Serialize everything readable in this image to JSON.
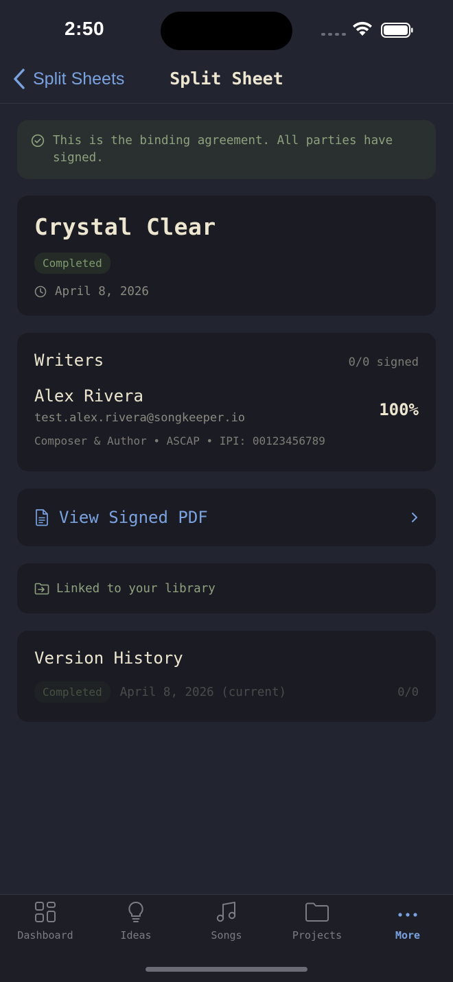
{
  "status_bar": {
    "time": "2:50"
  },
  "nav": {
    "back_label": "Split Sheets",
    "title": "Split Sheet"
  },
  "banner": {
    "text": "This is the binding agreement. All parties have signed."
  },
  "song": {
    "title": "Crystal Clear",
    "status": "Completed",
    "date": "April 8, 2026"
  },
  "writers": {
    "heading": "Writers",
    "signed": "0/0 signed",
    "items": [
      {
        "name": "Alex Rivera",
        "email": "test.alex.rivera@songkeeper.io",
        "meta": "Composer & Author • ASCAP • IPI: 00123456789",
        "share": "100%"
      }
    ]
  },
  "pdf": {
    "label": "View Signed PDF"
  },
  "library": {
    "label": "Linked to your library"
  },
  "history": {
    "heading": "Version History",
    "items": [
      {
        "status": "Completed",
        "date": "April 8, 2026 (current)",
        "count": "0/0"
      }
    ]
  },
  "tabs": [
    {
      "label": "Dashboard",
      "icon": "dashboard-icon"
    },
    {
      "label": "Ideas",
      "icon": "lightbulb-icon"
    },
    {
      "label": "Songs",
      "icon": "music-note-icon"
    },
    {
      "label": "Projects",
      "icon": "folder-icon"
    },
    {
      "label": "More",
      "icon": "more-dots-icon",
      "active": true
    }
  ],
  "colors": {
    "background": "#222430",
    "card": "#1b1c23",
    "accent_blue": "#7aa2e0",
    "success_green": "#8fa17e",
    "text_primary": "#ece5cf"
  }
}
